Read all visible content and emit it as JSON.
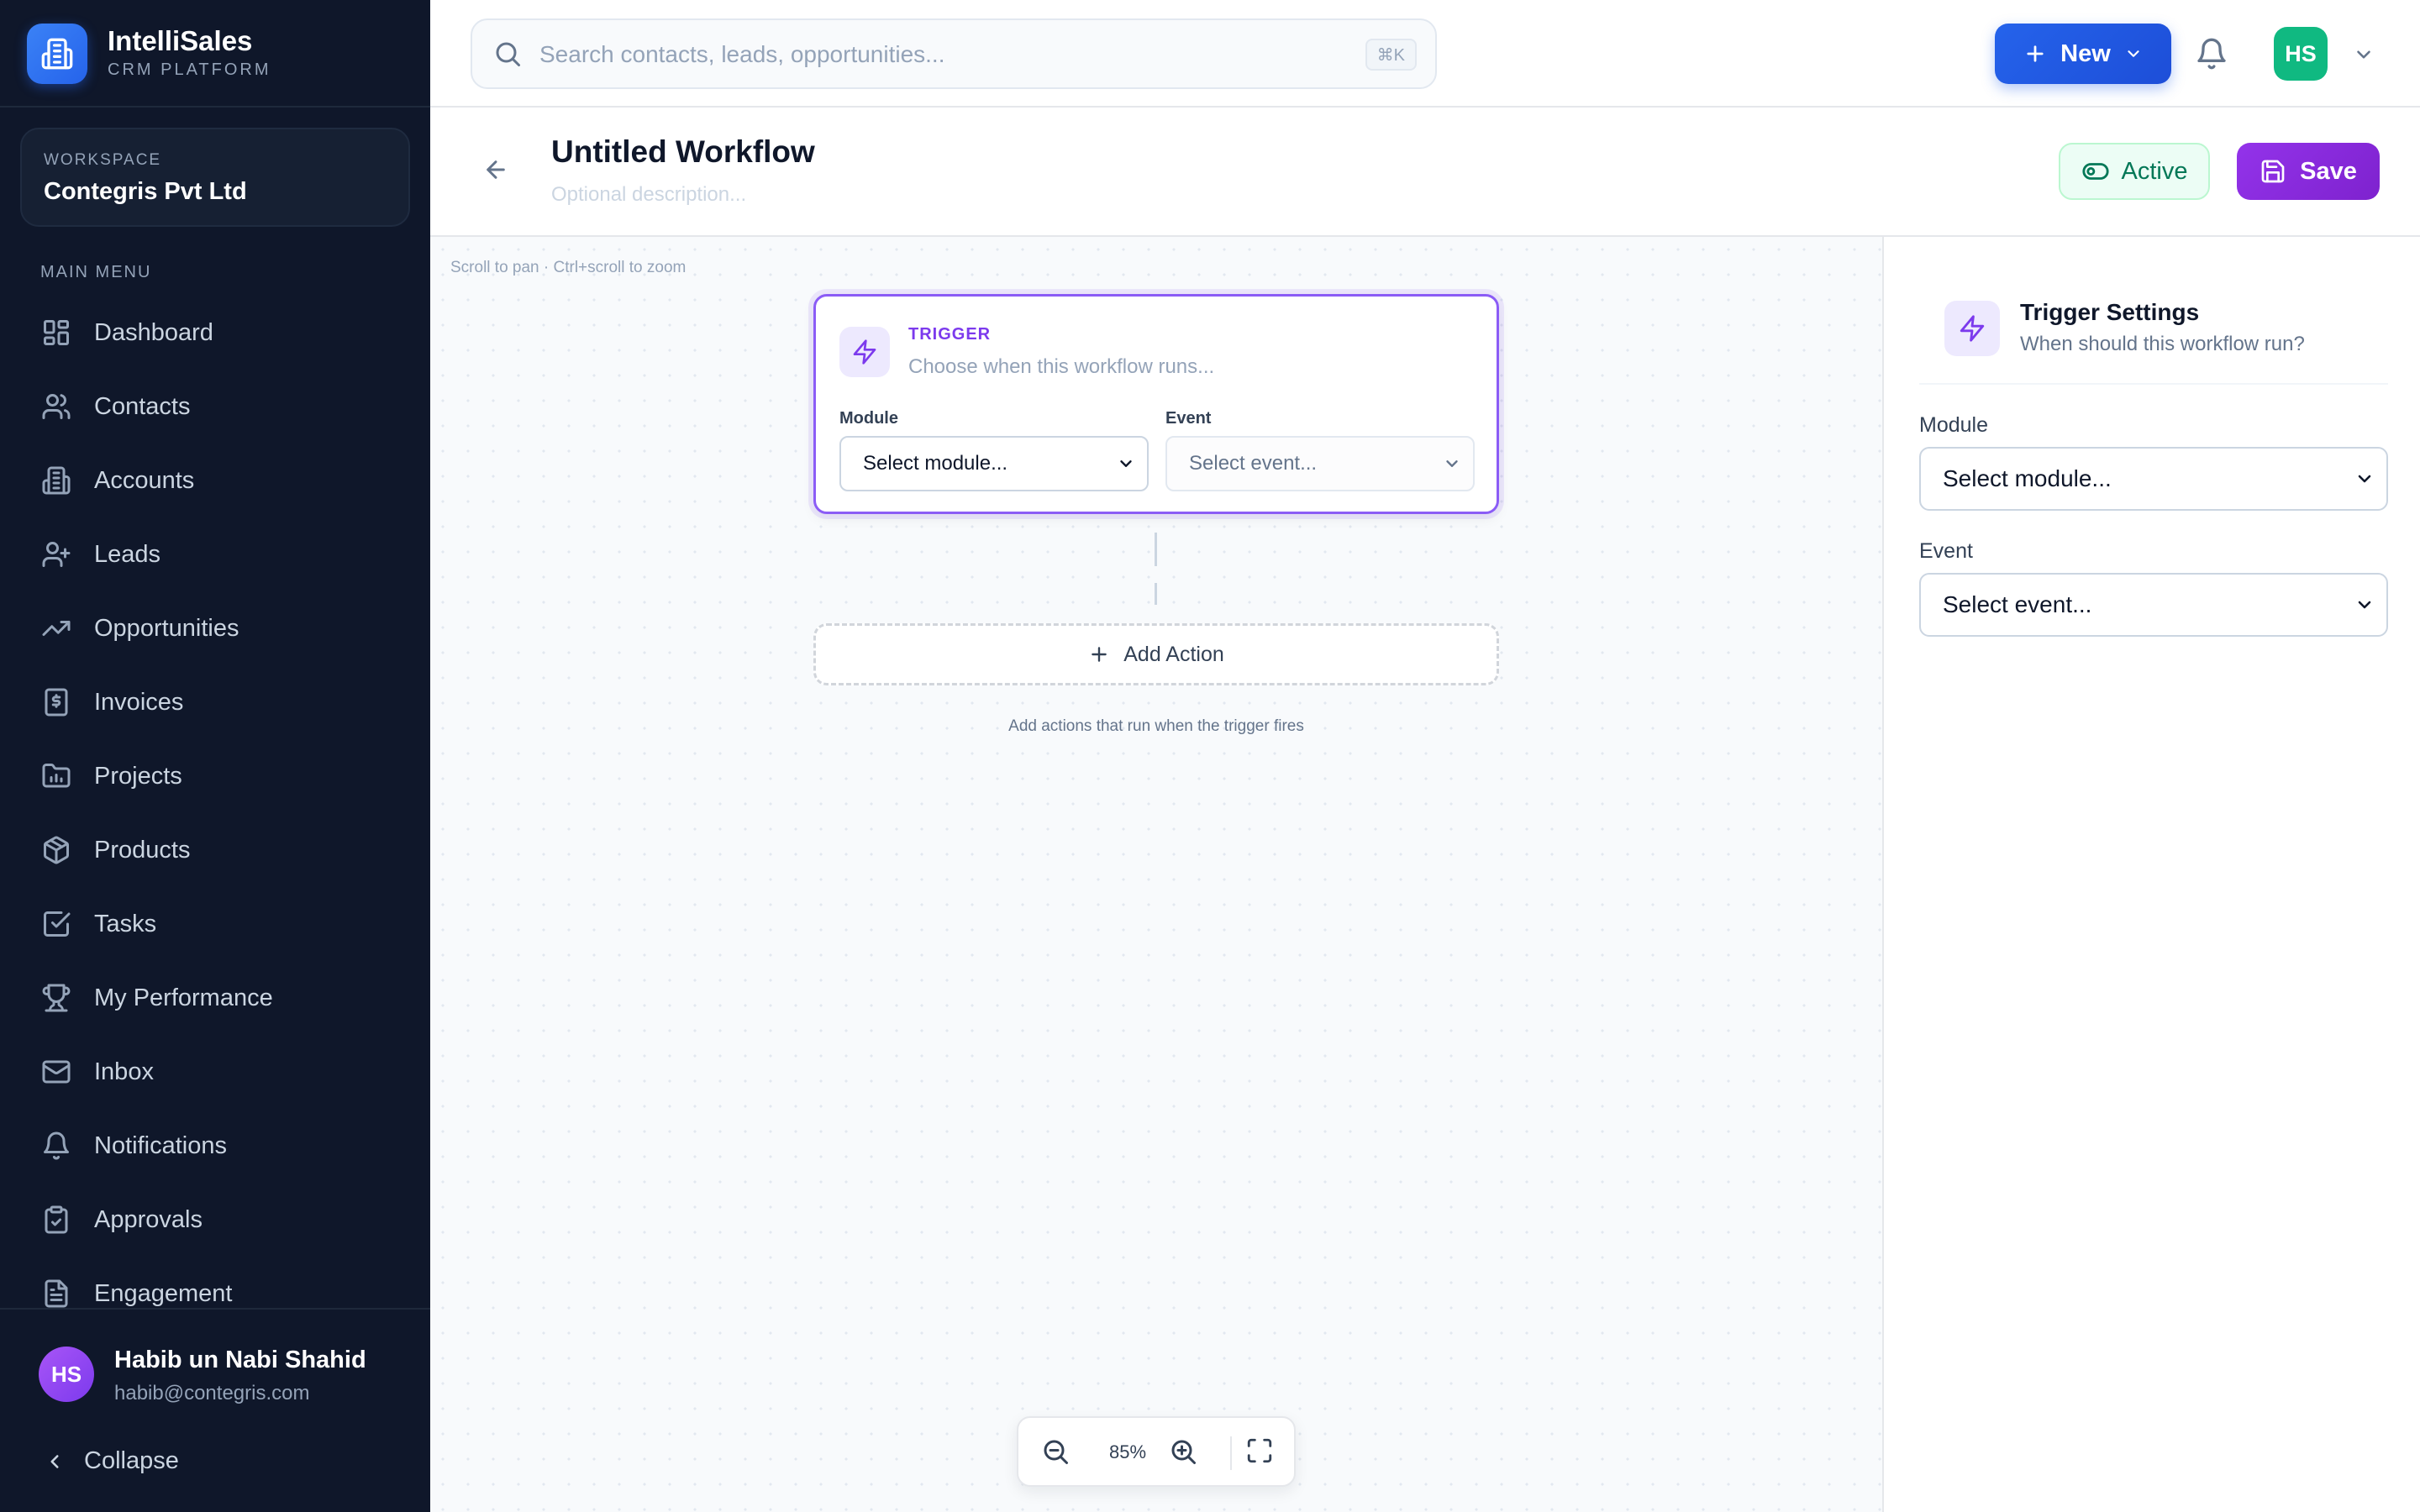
{
  "brand": {
    "name": "IntelliSales",
    "subtitle": "CRM PLATFORM"
  },
  "workspace": {
    "label": "WORKSPACE",
    "name": "Contegris Pvt Ltd"
  },
  "sidebar": {
    "heading": "MAIN MENU",
    "items": [
      {
        "label": "Dashboard",
        "icon": "dashboard-icon"
      },
      {
        "label": "Contacts",
        "icon": "users-icon"
      },
      {
        "label": "Accounts",
        "icon": "building-icon"
      },
      {
        "label": "Leads",
        "icon": "user-plus-icon"
      },
      {
        "label": "Opportunities",
        "icon": "trending-up-icon"
      },
      {
        "label": "Invoices",
        "icon": "receipt-dollar-icon"
      },
      {
        "label": "Projects",
        "icon": "folder-chart-icon"
      },
      {
        "label": "Products",
        "icon": "package-icon"
      },
      {
        "label": "Tasks",
        "icon": "check-square-icon"
      },
      {
        "label": "My Performance",
        "icon": "trophy-icon"
      },
      {
        "label": "Inbox",
        "icon": "mail-icon"
      },
      {
        "label": "Notifications",
        "icon": "bell-icon"
      },
      {
        "label": "Approvals",
        "icon": "clipboard-check-icon"
      },
      {
        "label": "Engagement",
        "icon": "file-text-icon"
      }
    ]
  },
  "user": {
    "initials": "HS",
    "name": "Habib un Nabi Shahid",
    "email": "habib@contegris.com"
  },
  "collapse_label": "Collapse",
  "topbar": {
    "search_placeholder": "Search contacts, leads, opportunities...",
    "search_shortcut": "⌘K",
    "new_label": "New",
    "avatar_initials": "HS"
  },
  "workflow": {
    "title": "Untitled Workflow",
    "description_placeholder": "Optional description...",
    "active_label": "Active",
    "save_label": "Save"
  },
  "canvas": {
    "hint": "Scroll to pan · Ctrl+scroll to zoom",
    "trigger": {
      "label": "TRIGGER",
      "subtitle": "Choose when this workflow runs...",
      "module_label": "Module",
      "module_value": "Select module...",
      "event_label": "Event",
      "event_value": "Select event..."
    },
    "add_action_label": "Add Action",
    "add_action_hint": "Add actions that run when the trigger fires",
    "zoom": "85%"
  },
  "panel": {
    "title": "Trigger Settings",
    "subtitle": "When should this workflow run?",
    "module_label": "Module",
    "module_value": "Select module...",
    "event_label": "Event",
    "event_value": "Select event..."
  },
  "colors": {
    "sidebar_bg": "#0f172a",
    "primary_blue": "#2563eb",
    "accent_purple": "#7e22ce",
    "active_green": "#047857"
  }
}
